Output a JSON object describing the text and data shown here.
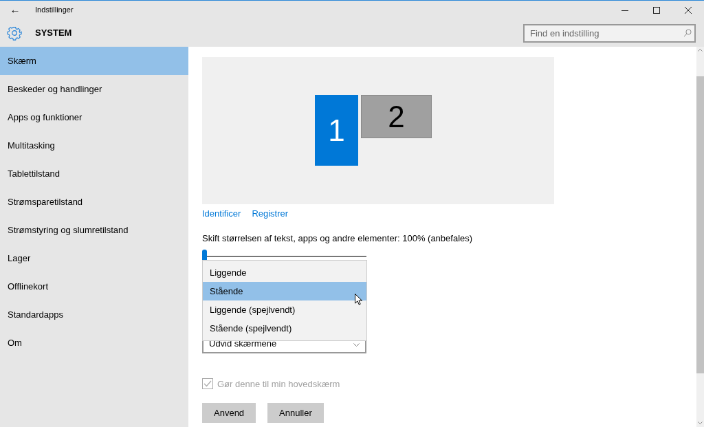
{
  "window": {
    "title": "Indstillinger",
    "back": "←"
  },
  "header": {
    "title": "SYSTEM",
    "search": {
      "placeholder": "Find en indstilling"
    }
  },
  "sidebar": {
    "items": [
      {
        "label": "Skærm",
        "selected": true
      },
      {
        "label": "Beskeder og handlinger",
        "selected": false
      },
      {
        "label": "Apps og funktioner",
        "selected": false
      },
      {
        "label": "Multitasking",
        "selected": false
      },
      {
        "label": "Tablettilstand",
        "selected": false
      },
      {
        "label": "Strømsparetilstand",
        "selected": false
      },
      {
        "label": "Strømstyring og slumretilstand",
        "selected": false
      },
      {
        "label": "Lager",
        "selected": false
      },
      {
        "label": "Offlinekort",
        "selected": false
      },
      {
        "label": "Standardapps",
        "selected": false
      },
      {
        "label": "Om",
        "selected": false
      }
    ]
  },
  "displays": [
    {
      "number": "1",
      "selected": true
    },
    {
      "number": "2",
      "selected": false
    }
  ],
  "links": [
    "Identificer",
    "Registrer"
  ],
  "scale": {
    "label": "Skift størrelsen af tekst, apps og andre elementer: 100% (anbefales)",
    "level": 0
  },
  "orientation_menu": {
    "options": [
      {
        "label": "Liggende",
        "selected": false
      },
      {
        "label": "Stående",
        "selected": true
      },
      {
        "label": "Liggende (spejlvendt)",
        "selected": false
      },
      {
        "label": "Stående (spejlvendt)",
        "selected": false
      }
    ]
  },
  "multiple_displays": {
    "value": "Udvid skærmene"
  },
  "main_display": {
    "label": "Gør denne til min hovedskærm",
    "checked": true,
    "disabled": true
  },
  "buttons": [
    "Anvend",
    "Annuller"
  ]
}
